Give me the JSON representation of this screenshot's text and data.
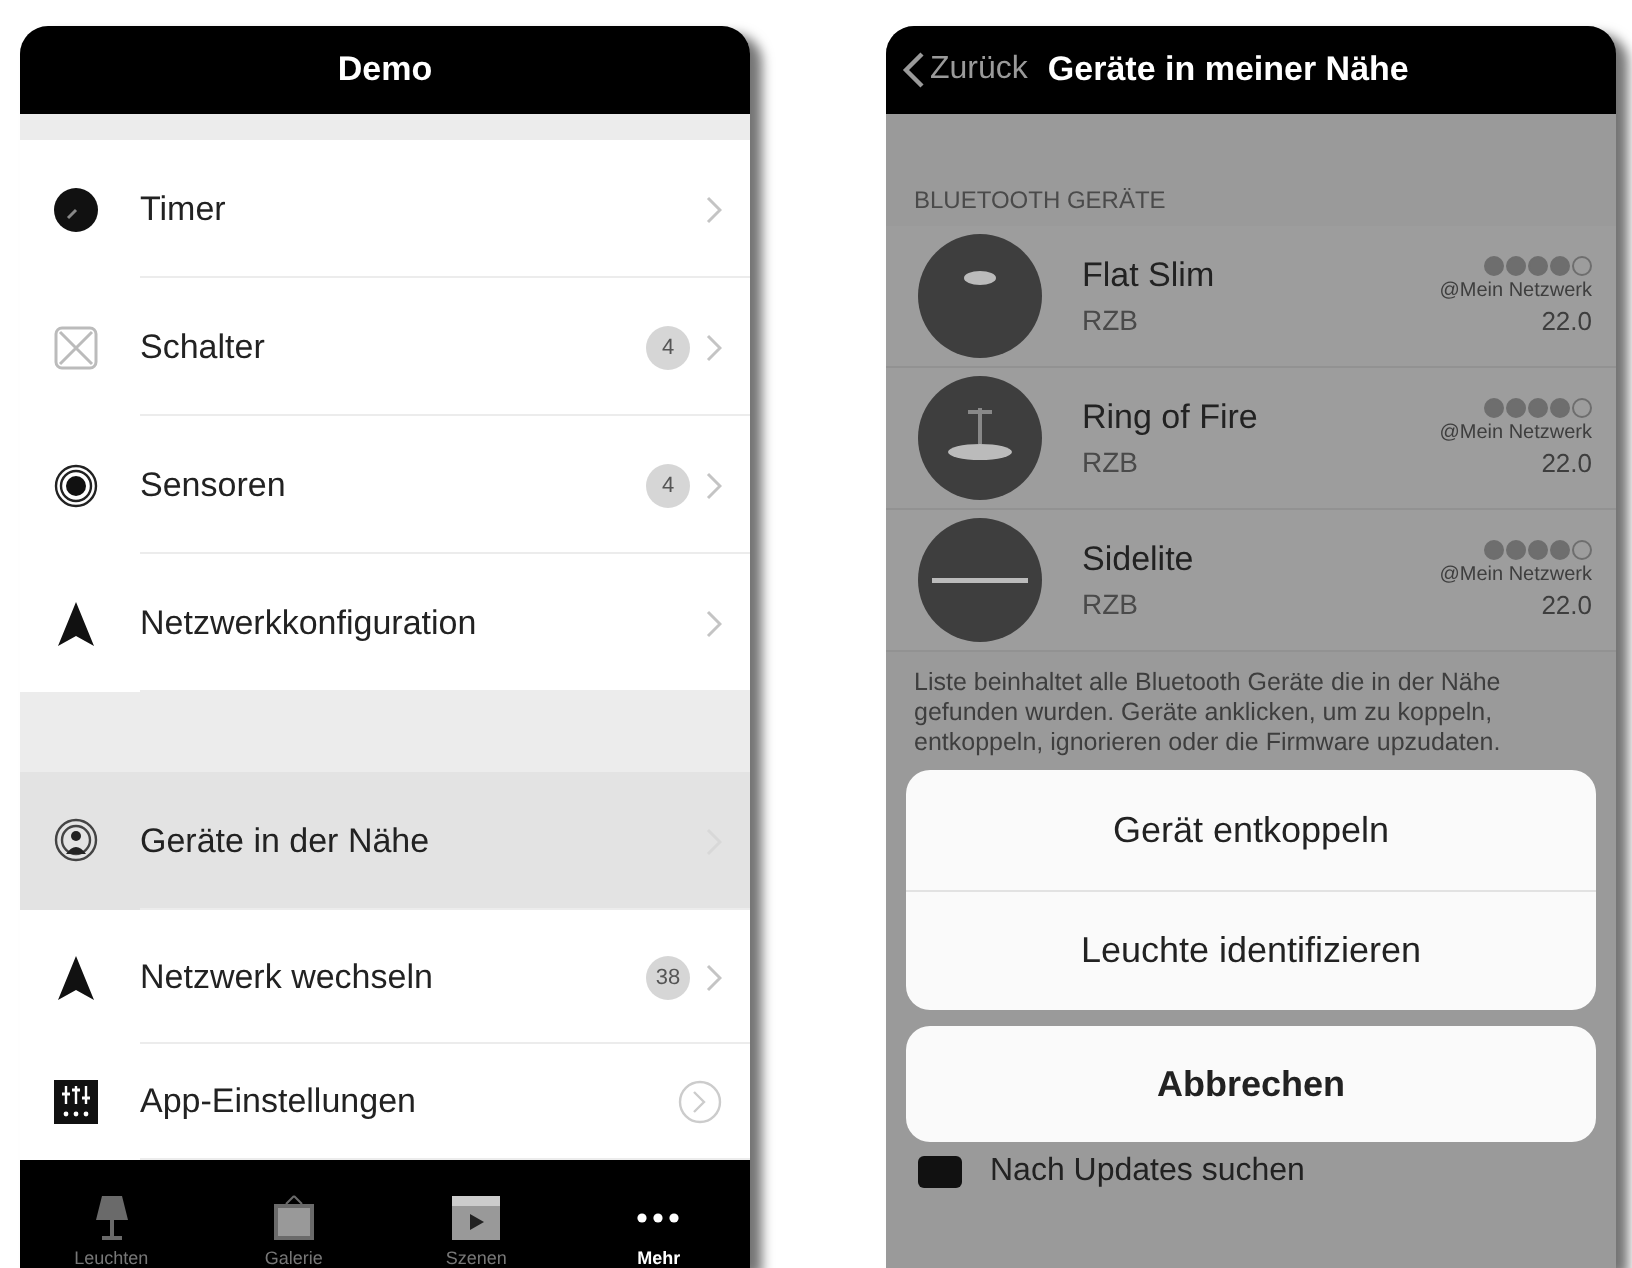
{
  "left_screen": {
    "title": "Demo",
    "menu_groups": [
      {
        "items": [
          {
            "label": "Timer",
            "selected": false
          },
          {
            "label": "Schalter",
            "badge": "4",
            "selected": false
          },
          {
            "label": "Sensoren",
            "badge": "4",
            "selected": false
          },
          {
            "label": "Netzwerkkonfiguration",
            "selected": false
          }
        ]
      },
      {
        "items": [
          {
            "label": "Geräte in der Nähe",
            "selected": true
          },
          {
            "label": "Netzwerk wechseln",
            "badge": "38",
            "selected": false
          },
          {
            "label": "App-Einstellungen",
            "selected": false
          }
        ]
      }
    ],
    "tabs": [
      {
        "label": "Leuchten",
        "selected": false
      },
      {
        "label": "Galerie",
        "selected": false
      },
      {
        "label": "Szenen",
        "selected": false
      },
      {
        "label": "Mehr",
        "selected": true
      }
    ]
  },
  "right_screen": {
    "back": "Zurück",
    "title": "Geräte in meiner Nähe",
    "section": "BLUETOOTH GERÄTE",
    "devices": [
      {
        "name": "Flat Slim",
        "maker": "RZB",
        "stars": 4,
        "network": "@Mein Netzwerk",
        "version": "22.0"
      },
      {
        "name": "Ring of Fire",
        "maker": "RZB",
        "stars": 4,
        "network": "@Mein Netzwerk",
        "version": "22.0"
      },
      {
        "name": "Sidelite",
        "maker": "RZB",
        "stars": 4,
        "network": "@Mein Netzwerk",
        "version": "22.0"
      }
    ],
    "footnote": "Liste beinhaltet alle Bluetooth Geräte die in der Nähe gefunden wurden. Geräte anklicken, um zu koppeln, entkoppeln, ignorieren oder die Firmware upzudaten.",
    "actions": [
      "Gerät entkoppeln",
      "Leuchte identifizieren"
    ],
    "cancel": "Abbrechen",
    "background_row": "Nach Updates suchen"
  }
}
